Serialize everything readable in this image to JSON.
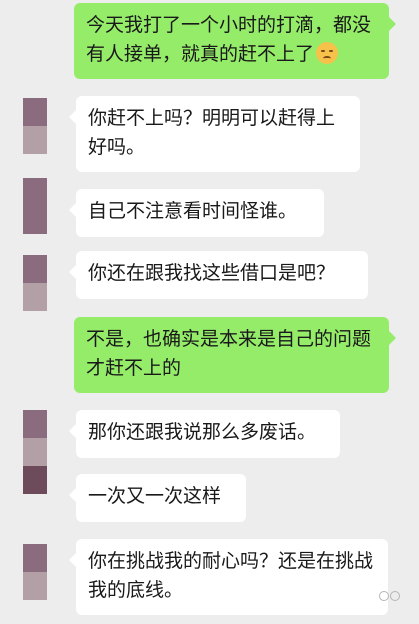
{
  "messages": [
    {
      "side": "right",
      "text": "今天我打了一个小时的打滴，都没有人接单，就真的赶不上了",
      "emoji": "pensive-face"
    },
    {
      "side": "left",
      "text": "你赶不上吗？明明可以赶得上好吗。"
    },
    {
      "side": "left",
      "text": "自己不注意看时间怪谁。"
    },
    {
      "side": "left",
      "text": "你还在跟我找这些借口是吧？"
    },
    {
      "side": "right",
      "text": "不是，也确实是本来是自己的问题才赶不上的"
    },
    {
      "side": "left",
      "text": "那你还跟我说那么多废话。"
    },
    {
      "side": "left",
      "text": "一次又一次这样"
    },
    {
      "side": "left",
      "text": "你在挑战我的耐心吗？还是在挑战我的底线。"
    }
  ],
  "colors": {
    "background": "#ededed",
    "sent_bubble": "#95ec69",
    "received_bubble": "#ffffff"
  }
}
